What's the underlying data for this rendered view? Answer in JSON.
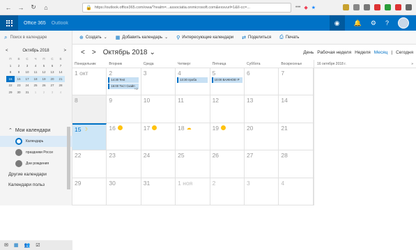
{
  "browser": {
    "url": "https://outlook.office365.com/owa/?realm=...associatia.onmicrosoft.com&exsvurl=1&II-cc=...",
    "menu_dots": "•••"
  },
  "suite": {
    "product": "Office 365",
    "app": "Outlook"
  },
  "commands": {
    "search_placeholder": "Поиск в календаре",
    "items": [
      {
        "label": "Создать",
        "icon": "plus-icon"
      },
      {
        "label": "Добавить календарь",
        "icon": "calendar-add-icon"
      },
      {
        "label": "Интересующие календари",
        "icon": "pin-icon"
      },
      {
        "label": "Поделиться",
        "icon": "share-icon"
      },
      {
        "label": "Печать",
        "icon": "print-icon"
      }
    ]
  },
  "mini_calendar": {
    "title": "Октябрь 2018",
    "weekdays": [
      "П",
      "В",
      "С",
      "Ч",
      "П",
      "С",
      "В"
    ],
    "rows": [
      [
        "1",
        "2",
        "3",
        "4",
        "5",
        "6",
        "7"
      ],
      [
        "8",
        "9",
        "10",
        "11",
        "12",
        "13",
        "14"
      ],
      [
        "15",
        "16",
        "17",
        "18",
        "19",
        "20",
        "21"
      ],
      [
        "22",
        "23",
        "24",
        "25",
        "26",
        "27",
        "28"
      ],
      [
        "29",
        "30",
        "31",
        "1",
        "2",
        "3",
        "4"
      ]
    ]
  },
  "calendars": {
    "heading": "Мои календари",
    "items": [
      {
        "label": "Календарь",
        "color": "#c8d7e8"
      },
      {
        "label": "праздники Росси",
        "color": "#7a7a7a"
      },
      {
        "label": "Дни рождения",
        "color": "#7a7a7a"
      }
    ],
    "other": "Другие календари",
    "shared": "Календари польз"
  },
  "calendar": {
    "month_label": "Октябрь 2018",
    "views": [
      "День",
      "Рабочая неделя",
      "Неделя",
      "Месяц",
      "Сегодня"
    ],
    "active_view": "Месяц",
    "weekdays": [
      "Понедельник",
      "Вторник",
      "Среда",
      "Четверг",
      "Пятница",
      "Суббота",
      "Воскресенье"
    ],
    "weeks": [
      [
        "1 окт",
        "2",
        "3",
        "4",
        "5",
        "6",
        "7"
      ],
      [
        "8",
        "9",
        "10",
        "11",
        "12",
        "13",
        "14"
      ],
      [
        "15",
        "16",
        "17",
        "18",
        "19",
        "20",
        "21"
      ],
      [
        "22",
        "23",
        "24",
        "25",
        "26",
        "27",
        "28"
      ],
      [
        "29",
        "30",
        "31",
        "1 ноя",
        "2",
        "3",
        "4"
      ]
    ],
    "events": {
      "tue1": "14:30 Test",
      "tue2": "16:00 Тест Скайп",
      "thu": "13:30 проба",
      "fri": "10:00 ВАЖНОЕ! Р",
      "more": "+2"
    }
  },
  "agenda": {
    "date": "16 октября 2018 г."
  }
}
